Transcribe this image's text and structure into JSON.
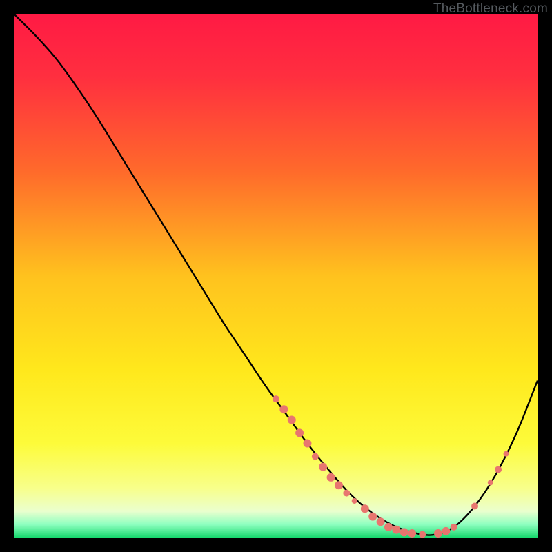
{
  "attribution": "TheBottleneck.com",
  "gradient_stops": [
    {
      "offset": 0.0,
      "color": "#ff1a44"
    },
    {
      "offset": 0.12,
      "color": "#ff2f3f"
    },
    {
      "offset": 0.3,
      "color": "#ff6a2b"
    },
    {
      "offset": 0.5,
      "color": "#ffc21e"
    },
    {
      "offset": 0.68,
      "color": "#ffe81c"
    },
    {
      "offset": 0.82,
      "color": "#fdfb3a"
    },
    {
      "offset": 0.905,
      "color": "#f8ff8a"
    },
    {
      "offset": 0.95,
      "color": "#eaffce"
    },
    {
      "offset": 0.975,
      "color": "#8effc0"
    },
    {
      "offset": 1.0,
      "color": "#17d86e"
    }
  ],
  "marker_color": "#e8766f",
  "curve_color": "#000000",
  "chart_data": {
    "type": "line",
    "title": "",
    "xlabel": "",
    "ylabel": "",
    "xlim": [
      0,
      100
    ],
    "ylim": [
      0,
      100
    ],
    "series": [
      {
        "name": "bottleneck-curve",
        "x": [
          0,
          4,
          8,
          12,
          16,
          20,
          24,
          28,
          32,
          36,
          40,
          44,
          48,
          52,
          56,
          60,
          64,
          68,
          72,
          76,
          80,
          84,
          88,
          92,
          96,
          100
        ],
        "y": [
          100,
          96,
          91.5,
          86,
          80,
          73.5,
          67,
          60.5,
          54,
          47.5,
          41,
          35,
          29,
          23.5,
          18,
          13,
          8.5,
          5,
          2.5,
          1,
          0.5,
          2,
          6,
          12,
          20,
          30
        ]
      }
    ],
    "markers": [
      {
        "x": 50,
        "y": 26.5,
        "r": 5
      },
      {
        "x": 51.5,
        "y": 24.5,
        "r": 6
      },
      {
        "x": 53,
        "y": 22.5,
        "r": 6
      },
      {
        "x": 54.5,
        "y": 20,
        "r": 6
      },
      {
        "x": 56,
        "y": 18,
        "r": 6
      },
      {
        "x": 57.5,
        "y": 15.5,
        "r": 5
      },
      {
        "x": 59,
        "y": 13.5,
        "r": 6
      },
      {
        "x": 60.5,
        "y": 11.5,
        "r": 6
      },
      {
        "x": 62,
        "y": 10,
        "r": 6
      },
      {
        "x": 63.5,
        "y": 8.5,
        "r": 5
      },
      {
        "x": 65,
        "y": 7,
        "r": 4
      },
      {
        "x": 67,
        "y": 5.5,
        "r": 6
      },
      {
        "x": 68.5,
        "y": 4,
        "r": 6
      },
      {
        "x": 70,
        "y": 3,
        "r": 6
      },
      {
        "x": 71.5,
        "y": 2,
        "r": 6
      },
      {
        "x": 73,
        "y": 1.5,
        "r": 6
      },
      {
        "x": 74.5,
        "y": 1,
        "r": 6
      },
      {
        "x": 76,
        "y": 0.8,
        "r": 6
      },
      {
        "x": 78,
        "y": 0.6,
        "r": 5
      },
      {
        "x": 81,
        "y": 0.8,
        "r": 6
      },
      {
        "x": 82.5,
        "y": 1.2,
        "r": 6
      },
      {
        "x": 84,
        "y": 2,
        "r": 5
      },
      {
        "x": 88,
        "y": 6,
        "r": 5
      },
      {
        "x": 91,
        "y": 10.5,
        "r": 4
      },
      {
        "x": 92.5,
        "y": 13,
        "r": 5
      },
      {
        "x": 94,
        "y": 16,
        "r": 4
      }
    ]
  }
}
